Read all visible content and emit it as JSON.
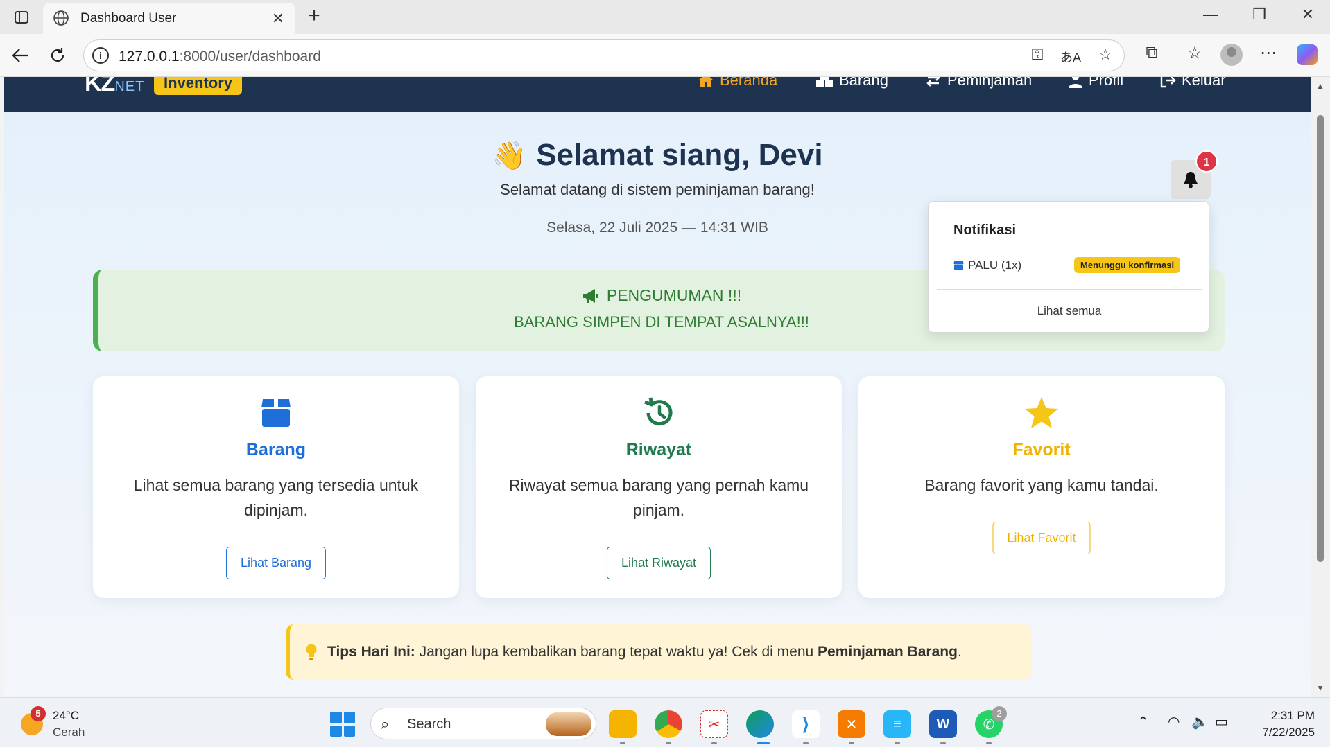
{
  "browser": {
    "tab_title": "Dashboard User",
    "tab_close": "✕",
    "new_tab": "+",
    "url_host": "127.0.0.1",
    "url_path": ":8000/user/dashboard",
    "minimize": "—",
    "restore": "❐",
    "close": "✕"
  },
  "site": {
    "brand": "KZ",
    "brand_suffix": "NET",
    "brand_badge": "Inventory",
    "nav": [
      {
        "label": "Beranda",
        "icon": "home-icon",
        "active": true
      },
      {
        "label": "Barang",
        "icon": "boxes-icon"
      },
      {
        "label": "Peminjaman",
        "icon": "exchange-icon"
      },
      {
        "label": "Profil",
        "icon": "user-icon"
      },
      {
        "label": "Keluar",
        "icon": "logout-icon"
      }
    ]
  },
  "greeting": {
    "title": "Selamat siang, Devi",
    "subtitle": "Selamat datang di sistem peminjaman barang!",
    "datetime": "Selasa, 22 Juli 2025 — 14:31 WIB"
  },
  "announcement": {
    "title": "PENGUMUMAN !!!",
    "body": "BARANG SIMPEN DI TEMPAT ASALNYA!!!"
  },
  "cards": [
    {
      "title": "Barang",
      "desc": "Lihat semua barang yang tersedia untuk dipinjam.",
      "button": "Lihat Barang",
      "color": "#1e6fd9",
      "icon": "box-icon"
    },
    {
      "title": "Riwayat",
      "desc": "Riwayat semua barang yang pernah kamu pinjam.",
      "button": "Lihat Riwayat",
      "color": "#1f7a4d",
      "icon": "history-icon"
    },
    {
      "title": "Favorit",
      "desc": "Barang favorit yang kamu tandai.",
      "button": "Lihat Favorit",
      "color": "#f0b400",
      "icon": "star-icon"
    }
  ],
  "tips": {
    "label": "Tips Hari Ini:",
    "text": "Jangan lupa kembalikan barang tepat waktu ya! Cek di menu",
    "link": "Peminjaman Barang",
    "end": "."
  },
  "notifications": {
    "count": "1",
    "title": "Notifikasi",
    "items": [
      {
        "text": "PALU (1x)",
        "status": "Menunggu konfirmasi"
      }
    ],
    "see_all": "Lihat semua"
  },
  "taskbar": {
    "weather_temp": "24°C",
    "weather_desc": "Cerah",
    "weather_badge": "5",
    "search": "Search",
    "whatsapp_badge": "2",
    "time": "2:31 PM",
    "date": "7/22/2025"
  }
}
